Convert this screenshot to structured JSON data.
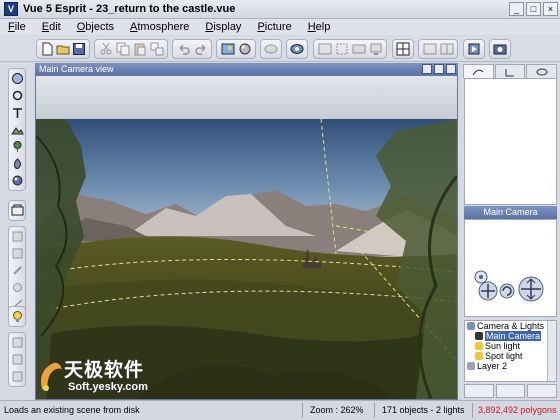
{
  "window": {
    "title": "Vue 5 Esprit - 23_return to the castle.vue",
    "app_icon": "V",
    "controls": [
      "minimize",
      "maximize",
      "close"
    ]
  },
  "menu": [
    "File",
    "Edit",
    "Objects",
    "Atmosphere",
    "Display",
    "Picture",
    "Help"
  ],
  "toolbar": {
    "icons": [
      "new-icon",
      "open-icon",
      "save-icon",
      "print-icon",
      "cut-icon",
      "copy-icon",
      "paste-icon",
      "duplicate-icon",
      "undo-icon",
      "redo-icon",
      "atmosphere-editor-icon",
      "material-icon",
      "render-preview-icon",
      "camera-icon",
      "viewport-layout-icon",
      "render-options-icon",
      "render-icon",
      "animation-icon"
    ]
  },
  "left_tools": {
    "icons": [
      "sphere-icon",
      "cylinder-icon",
      "cube-icon",
      "terrain-icon",
      "plant-icon",
      "rock-icon",
      "cloud-icon",
      "group-icon",
      "boolean-icon",
      "metablob-icon",
      "link-icon",
      "light-icon",
      "camera-tool-icon",
      "tree-tool-icon",
      "text-icon"
    ]
  },
  "viewport": {
    "title": "Main Camera view"
  },
  "right_panel": {
    "camera_title": "Main Camera",
    "tree": [
      {
        "label": "Camera & Lights",
        "level": 0,
        "selected": false
      },
      {
        "label": "Main Camera",
        "level": 1,
        "selected": true
      },
      {
        "label": "Sun light",
        "level": 1,
        "selected": false
      },
      {
        "label": "Spot light",
        "level": 1,
        "selected": false
      },
      {
        "label": "Layer 2",
        "level": 0,
        "selected": false
      }
    ]
  },
  "status": {
    "message": "Loads an existing scene from disk",
    "zoom": "Zoom : 262%",
    "objects": "171 objects - 2 lights",
    "polygons": "3,892,492 polygons"
  },
  "watermark": {
    "cn": "天极软件",
    "url": "Soft.yesky.com"
  },
  "colors": {
    "accent": "#5a72a8",
    "polygons": "#d01818"
  }
}
